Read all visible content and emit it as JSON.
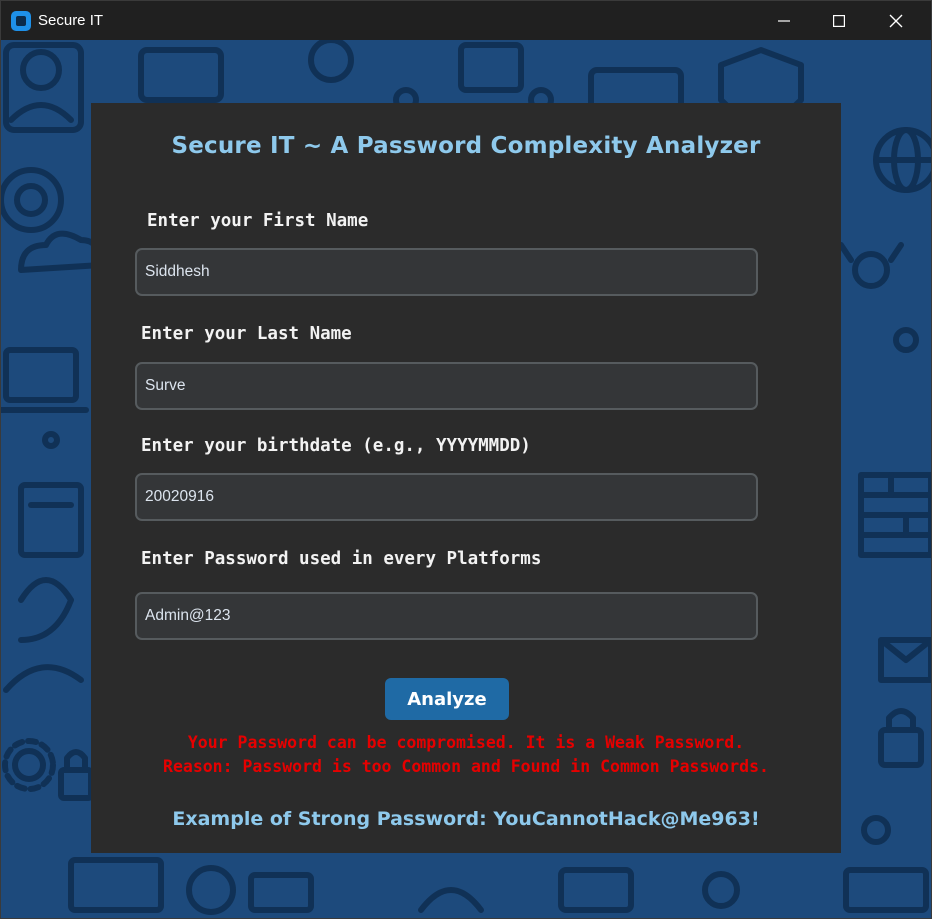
{
  "window": {
    "title": "Secure IT",
    "controls": {
      "minimize": "minimize-icon",
      "maximize": "maximize-icon",
      "close": "close-icon"
    }
  },
  "form": {
    "heading": "Secure IT ~ A Password Complexity Analyzer",
    "first_name_label": "Enter your First Name",
    "first_name_value": "Siddhesh",
    "last_name_label": "Enter your Last Name",
    "last_name_value": "Surve",
    "birthdate_label": "Enter your birthdate (e.g., YYYYMMDD)",
    "birthdate_value": "20020916",
    "password_label": "Enter Password used in every Platforms",
    "password_value": "Admin@123",
    "analyze_label": "Analyze",
    "result_line1": "Your Password can be compromised. It is a Weak Password.",
    "result_line2": "Reason: Password is too Common and Found in Common Passwords.",
    "example": "Example of Strong Password: YouCannotHack@Me963!"
  },
  "colors": {
    "accent": "#8ec9ec",
    "button": "#1f6aa5",
    "error": "#e60000",
    "panel": "#2b2b2b",
    "background": "#1d4a7c"
  }
}
